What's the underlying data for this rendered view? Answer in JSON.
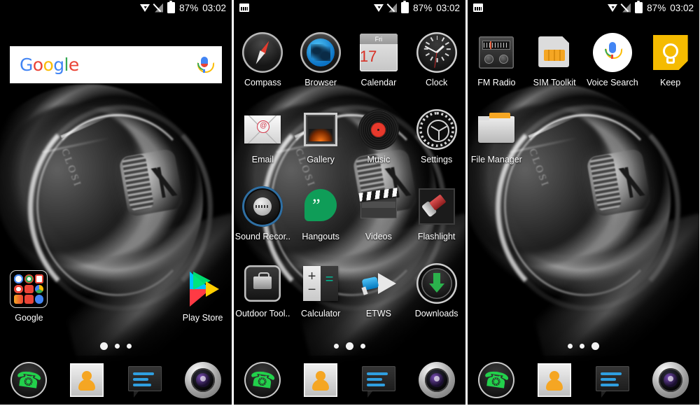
{
  "screens": [
    {
      "id": "home-screen",
      "status_bar": {
        "notification_icon": null,
        "wifi_icon": "wifi-icon",
        "signal_icon": "signal-off-icon",
        "battery_icon": "battery-icon",
        "battery_percent": "87%",
        "time": "03:02"
      },
      "search_widget": {
        "logo_letters": [
          "G",
          "o",
          "o",
          "g",
          "l",
          "e"
        ],
        "mic_icon": "microphone-icon"
      },
      "items": [
        {
          "label": "Google",
          "icon": "google-folder-icon",
          "type": "folder"
        },
        {
          "label": "Play Store",
          "icon": "play-store-icon",
          "type": "app"
        }
      ],
      "folder_apps": [
        "google-search",
        "chrome",
        "gmail",
        "photos",
        "youtube",
        "drive",
        "play-music",
        "play-movies",
        "duo"
      ],
      "page_indicator": {
        "count": 3,
        "active": 0
      }
    },
    {
      "id": "app-drawer-page-2",
      "status_bar": {
        "notification_icon": "screenshot-icon",
        "wifi_icon": "wifi-icon",
        "signal_icon": "signal-off-icon",
        "battery_icon": "battery-icon",
        "battery_percent": "87%",
        "time": "03:02"
      },
      "apps": [
        {
          "label": "Compass",
          "icon": "compass-icon"
        },
        {
          "label": "Browser",
          "icon": "browser-icon"
        },
        {
          "label": "Calendar",
          "icon": "calendar-icon",
          "day_name": "Fri",
          "day_number": "17"
        },
        {
          "label": "Clock",
          "icon": "clock-icon"
        },
        {
          "label": "Email",
          "icon": "email-icon"
        },
        {
          "label": "Gallery",
          "icon": "gallery-icon"
        },
        {
          "label": "Music",
          "icon": "music-icon"
        },
        {
          "label": "Settings",
          "icon": "settings-icon"
        },
        {
          "label": "Sound Recor..",
          "icon": "sound-recorder-icon"
        },
        {
          "label": "Hangouts",
          "icon": "hangouts-icon"
        },
        {
          "label": "Videos",
          "icon": "videos-icon"
        },
        {
          "label": "Flashlight",
          "icon": "flashlight-icon"
        },
        {
          "label": "Outdoor Tool..",
          "icon": "outdoor-toolkit-icon"
        },
        {
          "label": "Calculator",
          "icon": "calculator-icon"
        },
        {
          "label": "ETWS",
          "icon": "etws-icon"
        },
        {
          "label": "Downloads",
          "icon": "downloads-icon"
        }
      ],
      "page_indicator": {
        "count": 3,
        "active": 1
      }
    },
    {
      "id": "app-drawer-page-3",
      "status_bar": {
        "notification_icon": "screenshot-icon",
        "wifi_icon": "wifi-icon",
        "signal_icon": "signal-off-icon",
        "battery_icon": "battery-icon",
        "battery_percent": "87%",
        "time": "03:02"
      },
      "apps": [
        {
          "label": "FM Radio",
          "icon": "fm-radio-icon"
        },
        {
          "label": "SIM Toolkit",
          "icon": "sim-toolkit-icon"
        },
        {
          "label": "Voice Search",
          "icon": "voice-search-icon"
        },
        {
          "label": "Keep",
          "icon": "keep-icon"
        },
        {
          "label": "File Manager",
          "icon": "file-manager-icon"
        }
      ],
      "page_indicator": {
        "count": 3,
        "active": 2
      }
    }
  ],
  "dock": [
    {
      "label": "Phone",
      "icon": "phone-icon"
    },
    {
      "label": "Contacts",
      "icon": "contacts-icon"
    },
    {
      "label": "Messaging",
      "icon": "messaging-icon"
    },
    {
      "label": "Camera",
      "icon": "camera-icon"
    }
  ],
  "colors": {
    "wallpaper": "#000000",
    "google_blue": "#4285F4",
    "google_red": "#EA4335",
    "google_yellow": "#FBBC05",
    "google_green": "#34A853",
    "keep_yellow": "#F5BB00",
    "hangouts_green": "#0F9D58",
    "calendar_red": "#d93025",
    "separator": "#ffffff"
  },
  "folder_mini_colors": [
    "#ffffff",
    "#ffffff",
    "#ffffff",
    "#ffffff",
    "#e8392c",
    "#ffffff",
    "#f5a623",
    "#e8392c",
    "#4285F4"
  ]
}
